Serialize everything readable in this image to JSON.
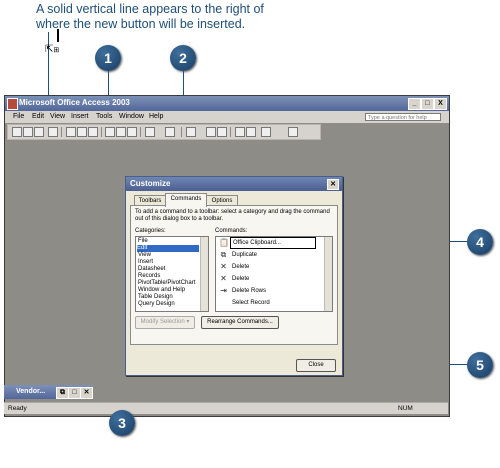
{
  "caption": {
    "line1": "A solid vertical line appears to the right of",
    "line2": "where the new button will be inserted."
  },
  "callouts": [
    "1",
    "2",
    "3",
    "4",
    "5"
  ],
  "window": {
    "title": "Microsoft Office Access 2003",
    "controls": [
      "_",
      "□",
      "X"
    ],
    "menu": [
      "File",
      "Edit",
      "View",
      "Insert",
      "Tools",
      "Window",
      "Help"
    ],
    "help_placeholder": "Type a question for help"
  },
  "dialog": {
    "title": "Customize",
    "tabs": [
      "Toolbars",
      "Commands",
      "Options"
    ],
    "active_tab": "Commands",
    "instruction": "To add a command to a toolbar: select a category and drag the command out of this dialog box to a toolbar.",
    "categories_label": "Categories:",
    "commands_label": "Commands:",
    "categories": [
      "File",
      "Edit",
      "View",
      "Insert",
      "Datasheet",
      "Records",
      "PivotTable/PivotChart",
      "Window and Help",
      "Table Design",
      "Query Design"
    ],
    "selected_category": "Edit",
    "commands": [
      {
        "icon": "clipboard-icon",
        "glyph": "📋",
        "label": "Office Clipboard..."
      },
      {
        "icon": "duplicate-icon",
        "glyph": "⧉",
        "label": "Duplicate"
      },
      {
        "icon": "delete-x-icon",
        "glyph": "✕",
        "label": "Delete"
      },
      {
        "icon": "delete-x-icon",
        "glyph": "✕",
        "label": "Delete"
      },
      {
        "icon": "delete-rows-icon",
        "glyph": "⇥",
        "label": "Delete Rows"
      },
      {
        "icon": "blank-icon",
        "glyph": "",
        "label": "Select Record"
      }
    ],
    "modify_selection": "Modify Selection ▾",
    "rearrange": "Rearrange Commands...",
    "close": "Close"
  },
  "vendor_window": "Vendor...",
  "status": {
    "left": "Ready",
    "right": "NUM"
  },
  "colors": {
    "accent": "#1e4e7a",
    "selection": "#316ac5"
  }
}
